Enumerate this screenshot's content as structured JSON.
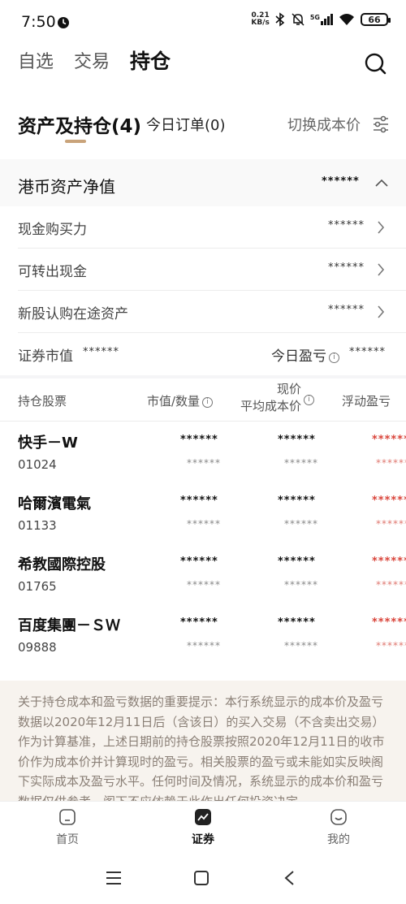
{
  "status": {
    "time": "7:50",
    "net_speed_value": "0.21",
    "net_speed_unit": "KB/s",
    "network": "5G",
    "battery": "66"
  },
  "header": {
    "tabs": [
      "自选",
      "交易",
      "持仓"
    ],
    "active_tab": "持仓"
  },
  "account": {
    "title": "资产及持仓(4)",
    "orders_tab": "今日订单(0)",
    "switch_cost": "切换成本价"
  },
  "net_asset": {
    "label": "港币资产净值",
    "value": "******",
    "items": [
      {
        "label": "现金购买力",
        "value": "******"
      },
      {
        "label": "可转出现金",
        "value": "******"
      },
      {
        "label": "新股认购在途资产",
        "value": "******"
      }
    ],
    "market_value_label": "证券市值",
    "market_value": "******",
    "today_pl_label": "今日盈亏",
    "today_pl": "******"
  },
  "holdings": {
    "headers": {
      "stock": "持仓股票",
      "mv_qty": "市值/数量",
      "price_top": "现价",
      "price_bottom": "平均成本价",
      "float_pl": "浮动盈亏"
    },
    "rows": [
      {
        "name": "快手－W",
        "code": "01024",
        "mv": "******",
        "qty": "******",
        "price": "******",
        "cost": "******",
        "pl": "******",
        "pl_pct": "******"
      },
      {
        "name": "哈爾濱電氣",
        "code": "01133",
        "mv": "******",
        "qty": "******",
        "price": "******",
        "cost": "******",
        "pl": "******",
        "pl_pct": "******"
      },
      {
        "name": "希教國際控股",
        "code": "01765",
        "mv": "******",
        "qty": "******",
        "price": "******",
        "cost": "******",
        "pl": "******",
        "pl_pct": "******"
      },
      {
        "name": "百度集團－ＳＷ",
        "code": "09888",
        "mv": "******",
        "qty": "******",
        "price": "******",
        "cost": "******",
        "pl": "******",
        "pl_pct": "******"
      }
    ]
  },
  "notice": {
    "text": "关于持仓成本和盈亏数据的重要提示：本行系统显示的成本价及盈亏数据以2020年12月11日后（含该日）的买入交易（不含卖出交易）作为计算基准，上述日期前的持仓股票按照2020年12月11日的收市价作为成本价并计算现时的盈亏。相关股票的盈亏或未能如实反映阁下实际成本及盈亏水平。任何时间及情况，系统显示的成本价和盈亏数据仅供参考，阁下不应依赖于此作出任何投资决定。"
  },
  "bottom_nav": {
    "items": [
      {
        "label": "首页"
      },
      {
        "label": "证券"
      },
      {
        "label": "我的"
      }
    ],
    "active": "证券"
  },
  "colors": {
    "accent_gold": "#c9a37a",
    "loss_red": "#d9443a",
    "notice_bg": "#f7f3ee"
  }
}
